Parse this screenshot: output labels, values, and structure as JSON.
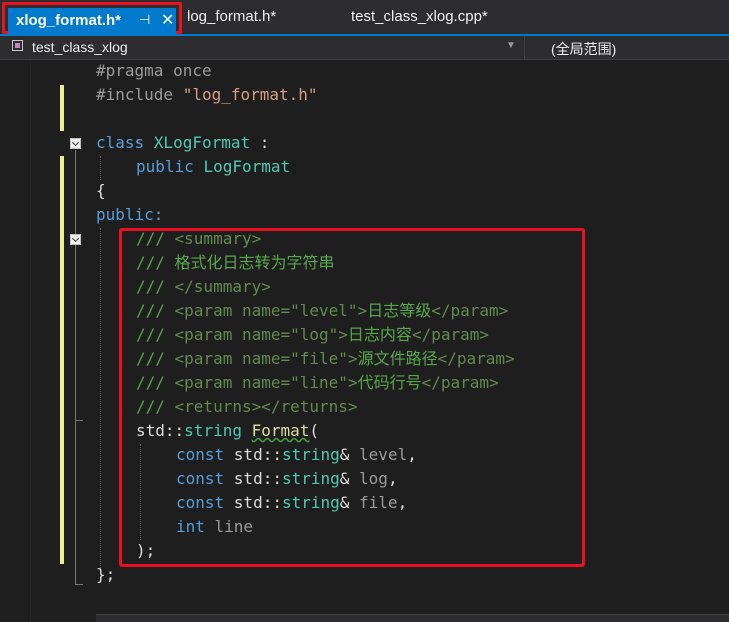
{
  "tabs": {
    "active": "xlog_format.h*",
    "second": "log_format.h*",
    "third": "test_class_xlog.cpp*"
  },
  "icons": {
    "pin": "pin-icon",
    "close": "close-icon",
    "class": "class-icon",
    "dropdown": "chevron-down-icon"
  },
  "navbar": {
    "class_scope": "test_class_xlog",
    "global_scope": "(全局范围)"
  },
  "code": {
    "l1": "#pragma once",
    "l2_a": "#include ",
    "l2_b": "\"log_format.h\"",
    "l4_a": "class ",
    "l4_b": "XLogFormat",
    "l4_c": " :",
    "l5_a": "public ",
    "l5_b": "LogFormat",
    "l6": "{",
    "l7": "public:",
    "l8_a": "/// ",
    "l8_b": "<summary>",
    "l9_a": "/// ",
    "l9_b": "格式化日志转为字符串",
    "l10_a": "/// ",
    "l10_b": "</summary>",
    "l11_a": "/// ",
    "l11_b": "<param name=\"level\">",
    "l11_c": "日志等级",
    "l11_d": "</param>",
    "l12_a": "/// ",
    "l12_b": "<param name=\"log\">",
    "l12_c": "日志内容",
    "l12_d": "</param>",
    "l13_a": "/// ",
    "l13_b": "<param name=\"file\">",
    "l13_c": "源文件路径",
    "l13_d": "</param>",
    "l14_a": "/// ",
    "l14_b": "<param name=\"line\">",
    "l14_c": "代码行号",
    "l14_d": "</param>",
    "l15_a": "/// ",
    "l15_b": "<returns></returns>",
    "l16_a": "std",
    "l16_b": "::",
    "l16_c": "string",
    "l16_d": " ",
    "l16_e": "Format",
    "l16_f": "(",
    "l17_a": "const ",
    "l17_b": "std",
    "l17_c": "::",
    "l17_d": "string",
    "l17_e": "& ",
    "l17_f": "level",
    "l17_g": ",",
    "l18_f": "log",
    "l19_f": "file",
    "l20_a": "int ",
    "l20_b": "line",
    "l21": ");",
    "l22": "};"
  },
  "colors": {
    "keyword": "#569cd6",
    "type": "#4ec9b0",
    "string": "#d69d85",
    "comment": "#57a64a",
    "highlight": "#e81123",
    "accent": "#007acc"
  }
}
